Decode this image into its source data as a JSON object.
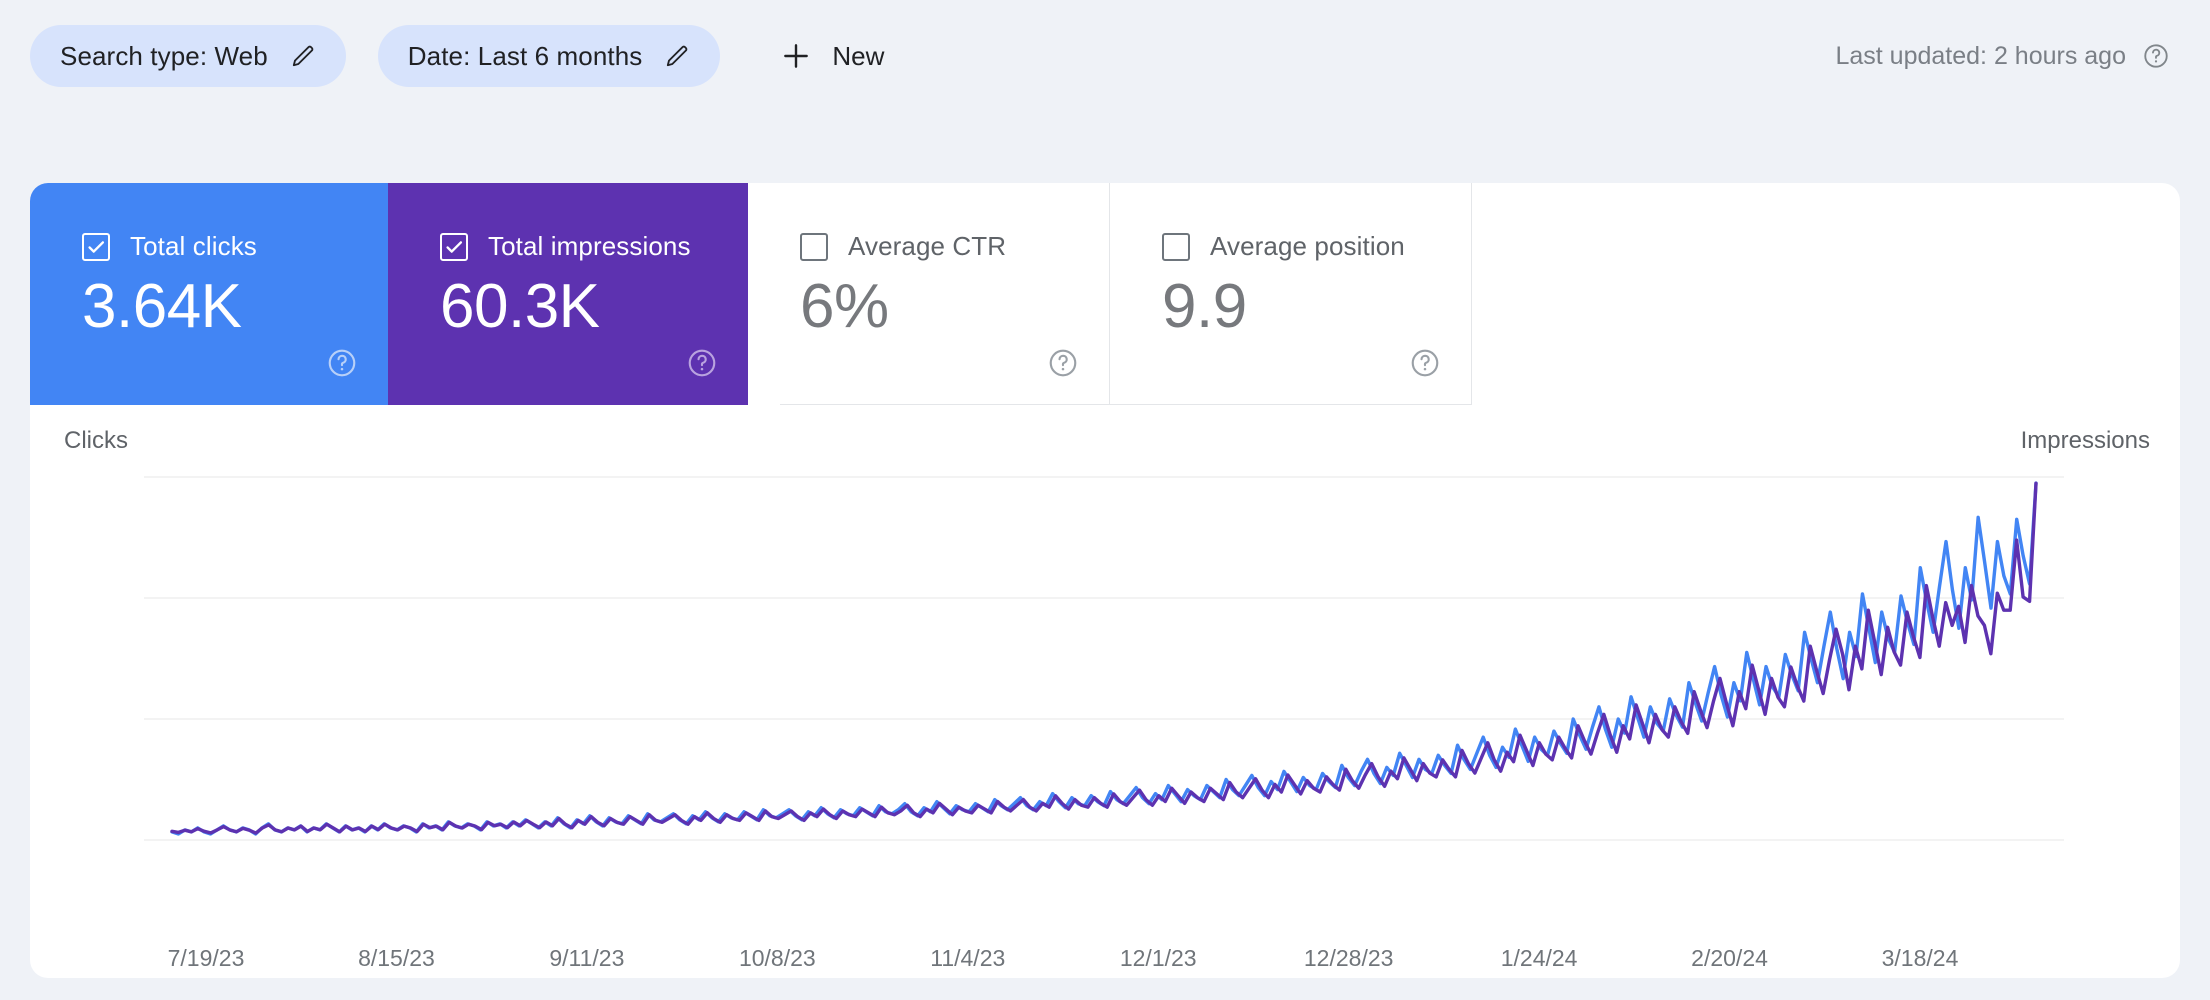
{
  "filters": {
    "chips": [
      {
        "label": "Search type: Web",
        "icon": "pencil-icon"
      },
      {
        "label": "Date: Last 6 months",
        "icon": "pencil-icon"
      }
    ],
    "new_button": {
      "label": "New",
      "icon": "plus-icon"
    },
    "last_updated": {
      "text": "Last updated: 2 hours ago",
      "icon": "help-circle-icon"
    }
  },
  "metric_cards": [
    {
      "title": "Total clicks",
      "value": "3.64K",
      "checked": true,
      "color": "#4285f4",
      "help_icon": "help-circle-icon"
    },
    {
      "title": "Total impressions",
      "value": "60.3K",
      "checked": true,
      "color": "#5d32b0",
      "help_icon": "help-circle-icon"
    },
    {
      "title": "Average CTR",
      "value": "6%",
      "checked": false,
      "color": "#ffffff",
      "help_icon": "help-circle-icon"
    },
    {
      "title": "Average position",
      "value": "9.9",
      "checked": false,
      "color": "#ffffff",
      "help_icon": "help-circle-icon"
    }
  ],
  "chart_data": {
    "type": "line",
    "title": "",
    "xlabel": "",
    "ylabel": "Clicks",
    "y2label": "Impressions",
    "grid": true,
    "legend_position": "none",
    "left_axis": {
      "label": "Clicks",
      "ticks": [
        "0",
        "60",
        "120",
        "180"
      ],
      "ylim": [
        0,
        180
      ]
    },
    "right_axis": {
      "label": "Impressions",
      "ticks": [
        "0",
        "750",
        "1.5K",
        "2.3K"
      ],
      "ylim": [
        0,
        2300
      ]
    },
    "x_ticks": [
      "7/19/23",
      "8/15/23",
      "9/11/23",
      "10/8/23",
      "11/4/23",
      "12/1/23",
      "12/28/23",
      "1/24/24",
      "2/20/24",
      "3/18/24"
    ],
    "series": [
      {
        "name": "Clicks",
        "color": "#4285f4",
        "axis": "left",
        "values": [
          4,
          3,
          5,
          4,
          6,
          4,
          3,
          5,
          7,
          5,
          4,
          6,
          5,
          3,
          6,
          8,
          5,
          4,
          6,
          5,
          7,
          4,
          6,
          5,
          8,
          6,
          4,
          7,
          5,
          6,
          4,
          7,
          5,
          8,
          6,
          5,
          7,
          6,
          4,
          8,
          6,
          7,
          5,
          9,
          7,
          6,
          8,
          7,
          5,
          9,
          7,
          8,
          6,
          9,
          7,
          10,
          8,
          6,
          9,
          7,
          11,
          8,
          6,
          10,
          8,
          12,
          9,
          7,
          11,
          9,
          8,
          12,
          10,
          8,
          13,
          10,
          9,
          11,
          13,
          10,
          8,
          12,
          10,
          14,
          11,
          9,
          13,
          11,
          10,
          14,
          12,
          10,
          15,
          12,
          11,
          13,
          15,
          12,
          10,
          14,
          12,
          16,
          13,
          11,
          15,
          13,
          12,
          16,
          14,
          12,
          17,
          14,
          13,
          15,
          18,
          14,
          12,
          16,
          14,
          19,
          16,
          13,
          17,
          15,
          14,
          18,
          16,
          14,
          20,
          17,
          15,
          18,
          21,
          17,
          15,
          19,
          17,
          23,
          19,
          16,
          21,
          18,
          17,
          22,
          19,
          17,
          24,
          20,
          18,
          22,
          26,
          21,
          18,
          23,
          20,
          27,
          23,
          19,
          25,
          22,
          20,
          27,
          24,
          21,
          30,
          25,
          22,
          27,
          32,
          26,
          22,
          29,
          25,
          34,
          29,
          24,
          31,
          27,
          25,
          33,
          29,
          26,
          37,
          31,
          27,
          34,
          40,
          33,
          28,
          36,
          32,
          43,
          37,
          31,
          40,
          35,
          33,
          42,
          37,
          33,
          47,
          40,
          35,
          43,
          51,
          42,
          36,
          46,
          41,
          55,
          47,
          39,
          51,
          45,
          42,
          54,
          48,
          43,
          60,
          52,
          45,
          56,
          66,
          55,
          46,
          60,
          53,
          71,
          61,
          51,
          66,
          58,
          54,
          70,
          62,
          56,
          78,
          68,
          59,
          73,
          86,
          72,
          61,
          78,
          69,
          93,
          80,
          67,
          86,
          76,
          71,
          92,
          82,
          74,
          103,
          90,
          78,
          96,
          113,
          95,
          80,
          103,
          91,
          122,
          105,
          88,
          113,
          100,
          93,
          121,
          108,
          97,
          135,
          118,
          103,
          126,
          148,
          124,
          105,
          135,
          119,
          160,
          138,
          115,
          148,
          131,
          122,
          159,
          141,
          127,
          177
        ]
      },
      {
        "name": "Impressions",
        "color": "#5d32b0",
        "axis": "right",
        "values": [
          55,
          48,
          62,
          52,
          72,
          55,
          45,
          64,
          85,
          63,
          52,
          74,
          62,
          44,
          76,
          96,
          64,
          52,
          76,
          64,
          88,
          54,
          76,
          65,
          100,
          76,
          52,
          88,
          64,
          76,
          54,
          88,
          66,
          100,
          76,
          64,
          88,
          76,
          54,
          100,
          78,
          88,
          65,
          112,
          88,
          76,
          100,
          88,
          66,
          112,
          90,
          100,
          78,
          114,
          90,
          124,
          100,
          78,
          114,
          90,
          136,
          100,
          78,
          124,
          100,
          148,
          112,
          90,
          136,
          112,
          100,
          148,
          124,
          100,
          160,
          124,
          112,
          136,
          160,
          124,
          100,
          148,
          124,
          172,
          136,
          112,
          160,
          136,
          124,
          172,
          148,
          124,
          184,
          148,
          136,
          160,
          184,
          148,
          124,
          172,
          148,
          196,
          160,
          136,
          184,
          160,
          148,
          196,
          172,
          148,
          208,
          172,
          160,
          184,
          220,
          172,
          148,
          196,
          172,
          232,
          196,
          160,
          208,
          184,
          172,
          220,
          196,
          172,
          244,
          208,
          184,
          220,
          256,
          208,
          184,
          232,
          208,
          280,
          232,
          196,
          256,
          220,
          208,
          268,
          232,
          208,
          292,
          244,
          220,
          268,
          316,
          256,
          220,
          280,
          244,
          328,
          280,
          232,
          304,
          268,
          244,
          328,
          292,
          256,
          364,
          304,
          268,
          328,
          388,
          316,
          268,
          352,
          304,
          412,
          352,
          292,
          376,
          328,
          304,
          400,
          352,
          316,
          448,
          376,
          328,
          412,
          484,
          400,
          340,
          436,
          388,
          520,
          448,
          376,
          484,
          424,
          400,
          508,
          448,
          400,
          568,
          484,
          424,
          520,
          616,
          508,
          436,
          556,
          496,
          664,
          568,
          472,
          616,
          544,
          508,
          652,
          580,
          520,
          724,
          628,
          544,
          676,
          796,
          664,
          556,
          724,
          640,
          856,
          736,
          616,
          796,
          700,
          652,
          844,
          748,
          676,
          940,
          820,
          712,
          880,
          1024,
          868,
          724,
          940,
          832,
          1108,
          952,
          796,
          1024,
          904,
          844,
          1096,
          976,
          880,
          1228,
          1072,
          928,
          1144,
          1336,
          1180,
          952,
          1228,
          1084,
          1456,
          1252,
          1048,
          1348,
          1192,
          1108,
          1444,
          1288,
          1156,
          1612,
          1408,
          1228,
          1504,
          1360,
          1480,
          1252,
          1612,
          1420,
          1360,
          1180,
          1564,
          1456,
          1456,
          1900,
          1540,
          1512,
          2260
        ]
      }
    ]
  }
}
